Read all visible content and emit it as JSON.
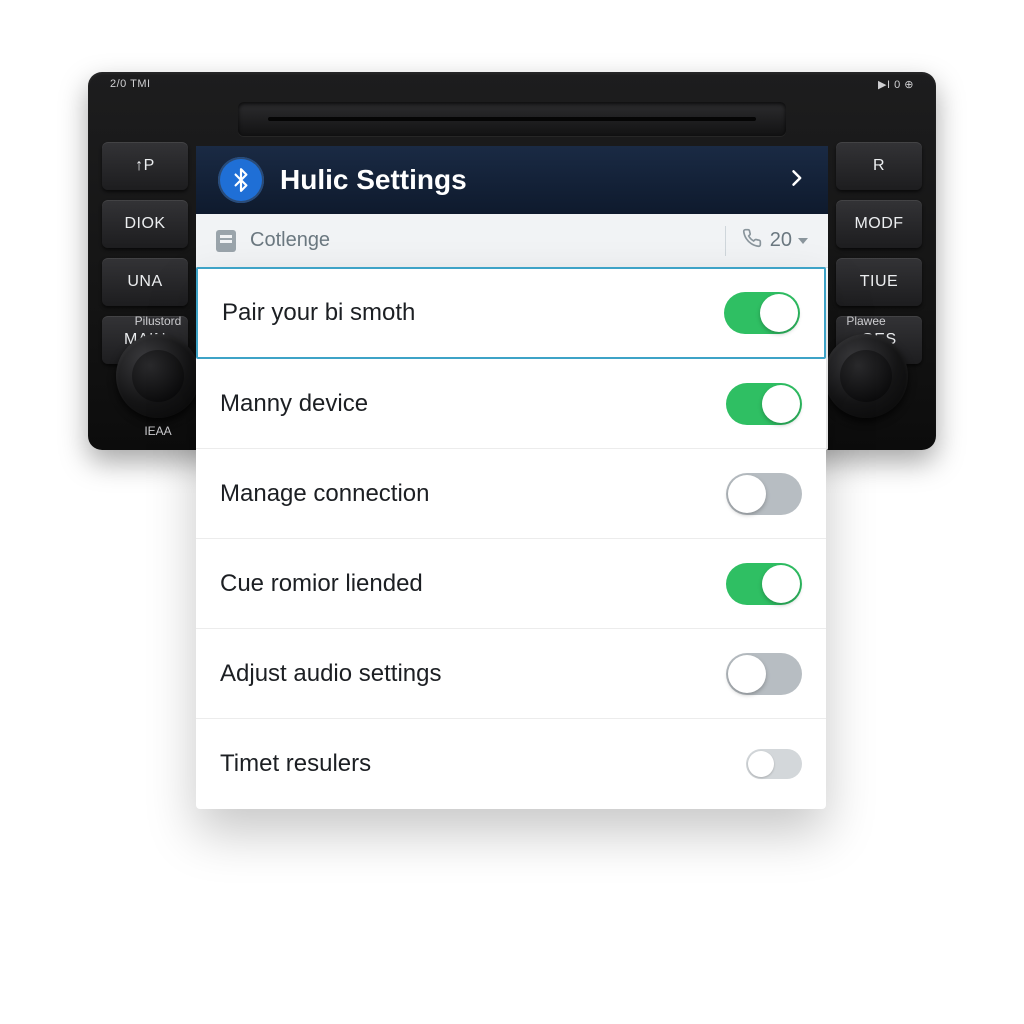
{
  "stereo": {
    "top_left_label": "2/0 TMI",
    "top_right_label": "▶I 0 ⊕",
    "left_buttons": [
      "↑P",
      "DIOK",
      "UNA",
      "MAIN"
    ],
    "right_buttons": [
      "R",
      "MODF",
      "TIUE",
      "GES"
    ],
    "knob_left_top_label": "Pilustord",
    "knob_left_bottom_label": "IEAA",
    "knob_right_top_label": "Plawee"
  },
  "header": {
    "title": "Hulic Settings"
  },
  "subbar": {
    "label": "Cotlenge",
    "count": "20"
  },
  "rows": [
    {
      "label": "Pair your bi smoth",
      "toggle": "on",
      "highlight": true
    },
    {
      "label": "Manny device",
      "toggle": "on",
      "highlight": false
    },
    {
      "label": "Manage connection",
      "toggle": "off",
      "highlight": false
    },
    {
      "label": "Cue romior liended",
      "toggle": "on",
      "highlight": false
    },
    {
      "label": "Adjust audio settings",
      "toggle": "off",
      "highlight": false
    },
    {
      "label": "Timet resulers",
      "toggle": "off-small",
      "highlight": false
    }
  ],
  "colors": {
    "accent_green": "#2fbf63",
    "highlight_border": "#3ea3c7",
    "header_bg": "#132741",
    "bt_blue": "#1f6fd6"
  }
}
